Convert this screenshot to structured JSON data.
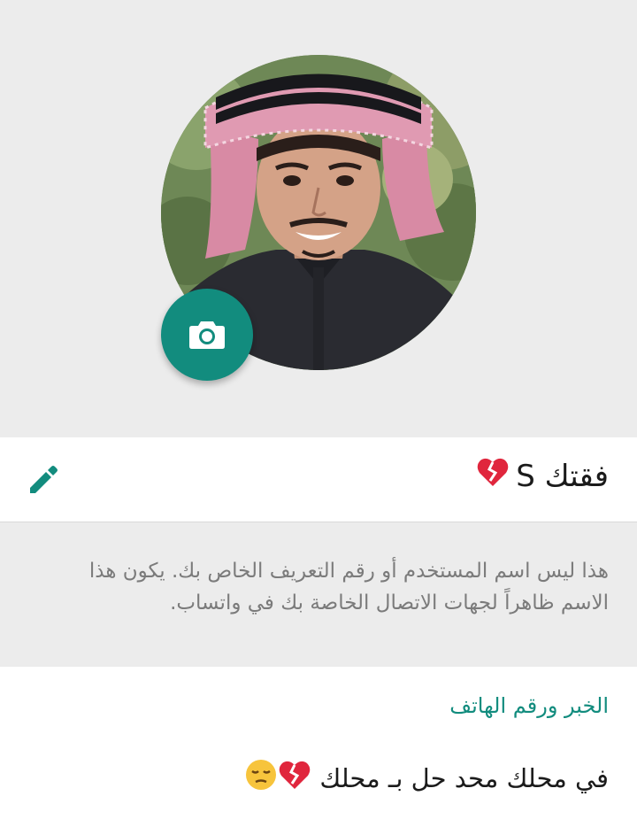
{
  "profile": {
    "name": "فقتك S",
    "name_hint": "هذا ليس اسم المستخدم أو رقم التعريف الخاص بك. يكون هذا الاسم ظاهراً لجهات الاتصال الخاصة بك في واتساب.",
    "about_title": "الخبر ورقم الهاتف",
    "about_text": "في محلك محد حل بـ محلك",
    "photo_icon": "camera-icon",
    "edit_icon": "pencil-icon",
    "emoji": [
      "broken-heart",
      "pensive-face"
    ]
  },
  "colors": {
    "accent": "#128c7e",
    "background": "#ececec",
    "surface": "#ffffff",
    "hint_text": "#7b7b7b",
    "primary_text": "#1b1b1b"
  }
}
